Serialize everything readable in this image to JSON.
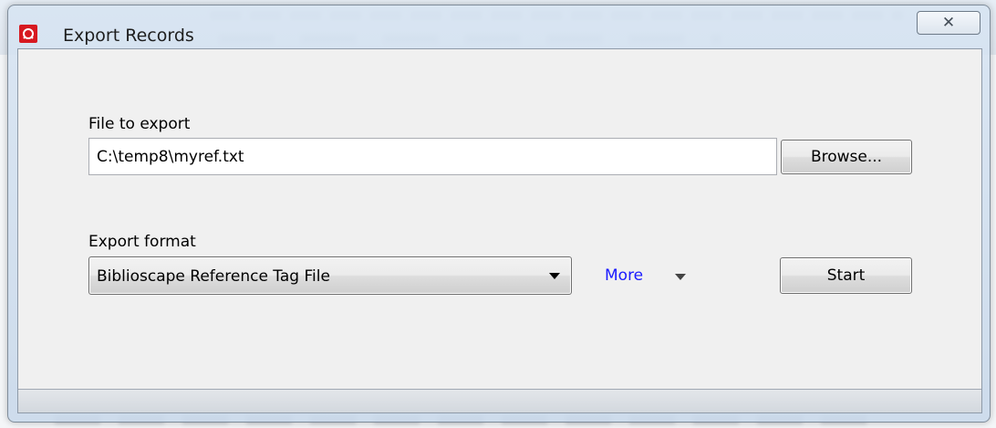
{
  "window": {
    "title": "Export Records",
    "app_icon": "biblioscape-logo-icon",
    "close_symbol": "✕"
  },
  "file_section": {
    "label": "File to export",
    "value": "C:\\temp8\\myref.txt",
    "browse_label": "Browse..."
  },
  "format_section": {
    "label": "Export format",
    "selected": "Biblioscape Reference Tag File",
    "more_label": "More",
    "start_label": "Start"
  },
  "colors": {
    "link": "#1a1aff",
    "app_icon": "#d71920"
  }
}
